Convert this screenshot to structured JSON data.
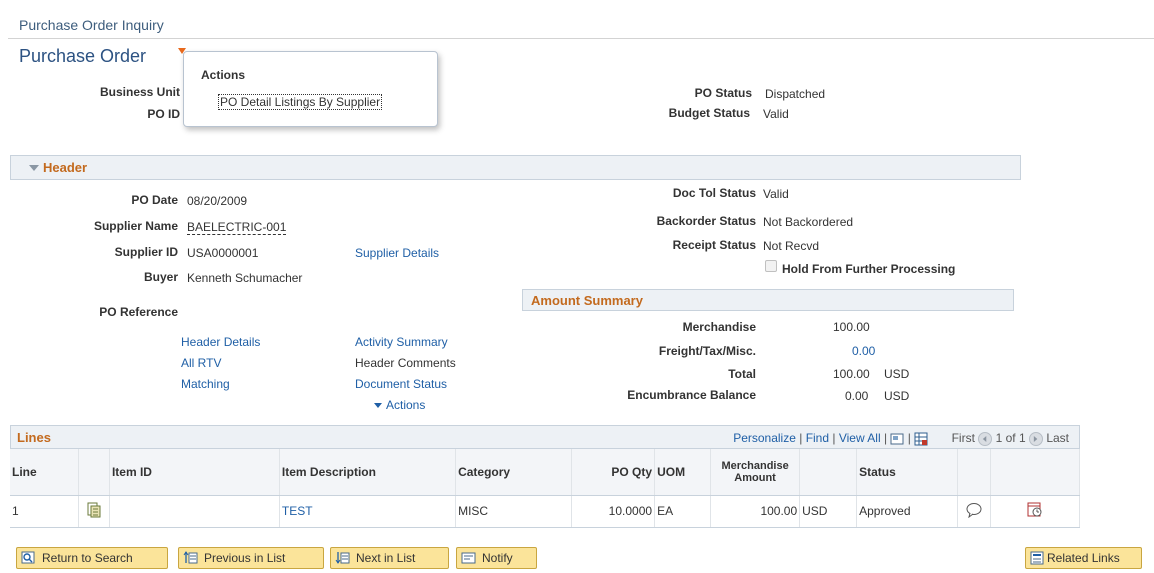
{
  "page": {
    "title": "Purchase Order Inquiry",
    "component_title": "Purchase Order"
  },
  "popup": {
    "heading": "Actions",
    "item": "PO Detail Listings By Supplier"
  },
  "top_fields": {
    "business_unit_label": "Business Unit",
    "po_id_label": "PO ID",
    "po_status_label": "PO Status",
    "po_status_value": "Dispatched",
    "budget_status_label": "Budget Status",
    "budget_status_value": "Valid"
  },
  "header_section": {
    "title": "Header",
    "po_date_label": "PO Date",
    "po_date_value": "08/20/2009",
    "supplier_name_label": "Supplier Name",
    "supplier_name_value": "BAELECTRIC-001",
    "supplier_id_label": "Supplier ID",
    "supplier_id_value": "USA0000001",
    "supplier_details_link": "Supplier Details",
    "buyer_label": "Buyer",
    "buyer_value": "Kenneth Schumacher",
    "po_reference_label": "PO Reference",
    "doc_tol_label": "Doc Tol Status",
    "doc_tol_value": "Valid",
    "backorder_label": "Backorder Status",
    "backorder_value": "Not Backordered",
    "receipt_label": "Receipt Status",
    "receipt_value": "Not Recvd",
    "hold_label": "Hold From Further Processing",
    "hold_checked": false,
    "links": {
      "header_details": "Header Details",
      "all_rtv": "All RTV",
      "matching": "Matching",
      "activity_summary": "Activity Summary",
      "header_comments": "Header Comments",
      "document_status": "Document Status",
      "actions": "Actions"
    }
  },
  "amount_summary": {
    "title": "Amount Summary",
    "merchandise_label": "Merchandise",
    "merchandise_value": "100.00",
    "freight_label": "Freight/Tax/Misc.",
    "freight_value": "0.00",
    "total_label": "Total",
    "total_value": "100.00",
    "total_currency": "USD",
    "encumbrance_label": "Encumbrance Balance",
    "encumbrance_value": "0.00",
    "encumbrance_currency": "USD"
  },
  "lines_grid": {
    "title": "Lines",
    "personalize": "Personalize",
    "find": "Find",
    "view_all": "View All",
    "first": "First",
    "page_count": "1 of 1",
    "last": "Last",
    "columns": [
      "Line",
      "Item ID",
      "Item Description",
      "Category",
      "PO Qty",
      "UOM",
      "Merchandise Amount",
      "Status"
    ],
    "rows": [
      {
        "line": "1",
        "item_id": "",
        "description": "TEST",
        "category": "MISC",
        "po_qty": "10.0000",
        "uom": "EA",
        "amount": "100.00",
        "currency": "USD",
        "status": "Approved"
      }
    ]
  },
  "toolbar": {
    "return_to_search": "Return to Search",
    "previous_in_list": "Previous in List",
    "next_in_list": "Next in List",
    "notify": "Notify",
    "related_links": "Related Links"
  },
  "colors": {
    "section_title": "#c36a1e",
    "link": "#1f5fa6",
    "button": "#fbe49a",
    "section_bar": "#edf1f5"
  }
}
